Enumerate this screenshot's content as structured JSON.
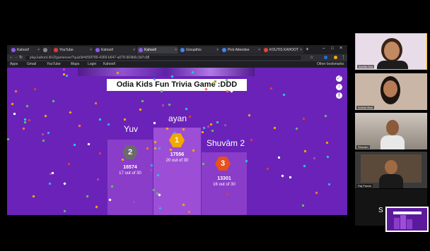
{
  "browser": {
    "tabs": [
      {
        "label": "Kahoot!",
        "fav": "#8b5cf6"
      },
      {
        "label": "",
        "fav": "#888"
      },
      {
        "label": "YouTube",
        "fav": "#e53935"
      },
      {
        "label": "Kahoot!",
        "fav": "#8b5cf6"
      },
      {
        "label": "Kahoot!",
        "fav": "#8b5cf6",
        "active": true
      },
      {
        "label": "Groupthis",
        "fav": "#4285f4"
      },
      {
        "label": "Pick Attendee",
        "fav": "#4285f4"
      },
      {
        "label": "KOUTIS KAHOOT",
        "fav": "#ea4335"
      }
    ],
    "url": "play.kahoot.it/v2/gameover?quizId=b56f789-4369-b647-a078-964b5c3d7c98",
    "bookmarks": [
      "Apps",
      "Gmail",
      "YouTube",
      "Maps",
      "Login",
      "Kahoot!"
    ],
    "bookmarks_right": "Other bookmarks"
  },
  "game": {
    "title": "Odia Kids Fun Trivia Game :DDD",
    "podium": [
      {
        "rank": "2",
        "name": "Yuv",
        "score": "16574",
        "detail": "17 out of 30",
        "badge_color": "#6b6b6b"
      },
      {
        "rank": "1",
        "name": "ayan",
        "score": "17556",
        "detail": "20 out of 30",
        "badge_color": "#f2a900"
      },
      {
        "rank": "3",
        "name": "Shuvam 2",
        "score": "13301",
        "detail": "16 out of 30",
        "badge_color": "#e8501e"
      }
    ]
  },
  "participants": [
    {
      "name": "Asmita Das"
    },
    {
      "name": "Anisha Busi"
    },
    {
      "name": "Shuvam"
    },
    {
      "name": "Raj Panda"
    }
  ],
  "sharing_label": "S"
}
